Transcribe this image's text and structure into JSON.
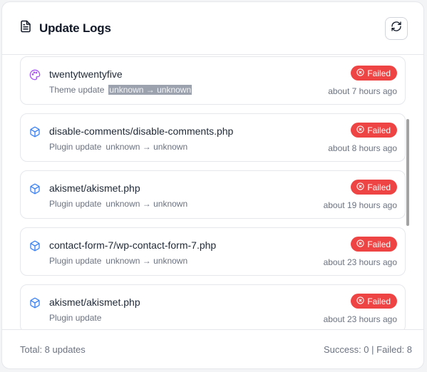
{
  "header": {
    "title": "Update Logs",
    "title_icon": "document-icon",
    "refresh_icon": "refresh-icon"
  },
  "logs": [
    {
      "name": "twentytwentyfive",
      "type": "Theme update",
      "version": "unknown → unknown",
      "status": "Failed",
      "time": "about 7 hours ago",
      "icon": "palette-icon"
    },
    {
      "name": "disable-comments/disable-comments.php",
      "type": "Plugin update",
      "version": "unknown → unknown",
      "status": "Failed",
      "time": "about 8 hours ago",
      "icon": "package-icon"
    },
    {
      "name": "akismet/akismet.php",
      "type": "Plugin update",
      "version": "unknown → unknown",
      "status": "Failed",
      "time": "about 19 hours ago",
      "icon": "package-icon"
    },
    {
      "name": "contact-form-7/wp-contact-form-7.php",
      "type": "Plugin update",
      "version": "unknown → unknown",
      "status": "Failed",
      "time": "about 23 hours ago",
      "icon": "package-icon"
    },
    {
      "name": "akismet/akismet.php",
      "type": "Plugin update",
      "version": "",
      "status": "Failed",
      "time": "about 23 hours ago",
      "icon": "package-icon"
    }
  ],
  "footer": {
    "total": "Total: 8 updates",
    "summary": "Success: 0 | Failed: 8"
  },
  "colors": {
    "failed": "#ef4444",
    "theme_icon": "#a855f7",
    "plugin_icon": "#3b82f6"
  }
}
